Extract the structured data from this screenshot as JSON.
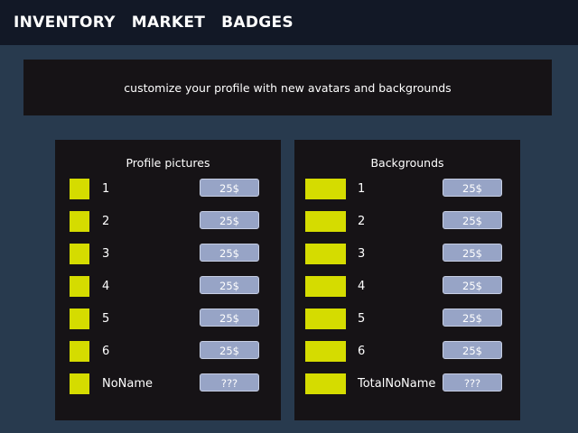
{
  "nav": {
    "items": [
      "INVENTORY",
      "MARKET",
      "BADGES"
    ]
  },
  "banner": {
    "text": "customize your profile with new avatars and backgrounds"
  },
  "profile_pictures": {
    "title": "Profile pictures",
    "items": [
      {
        "label": "1",
        "price": "25$"
      },
      {
        "label": "2",
        "price": "25$"
      },
      {
        "label": "3",
        "price": "25$"
      },
      {
        "label": "4",
        "price": "25$"
      },
      {
        "label": "5",
        "price": "25$"
      },
      {
        "label": "6",
        "price": "25$"
      },
      {
        "label": "NoName",
        "price": "???"
      }
    ]
  },
  "backgrounds": {
    "title": "Backgrounds",
    "items": [
      {
        "label": "1",
        "price": "25$"
      },
      {
        "label": "2",
        "price": "25$"
      },
      {
        "label": "3",
        "price": "25$"
      },
      {
        "label": "4",
        "price": "25$"
      },
      {
        "label": "5",
        "price": "25$"
      },
      {
        "label": "6",
        "price": "25$"
      },
      {
        "label": "TotalNoName",
        "price": "???"
      }
    ]
  },
  "colors": {
    "page_bg": "#283a4e",
    "nav_bg": "#121826",
    "panel_bg": "#161316",
    "swatch": "#d5dc00",
    "price_button": "#97a4c6"
  }
}
